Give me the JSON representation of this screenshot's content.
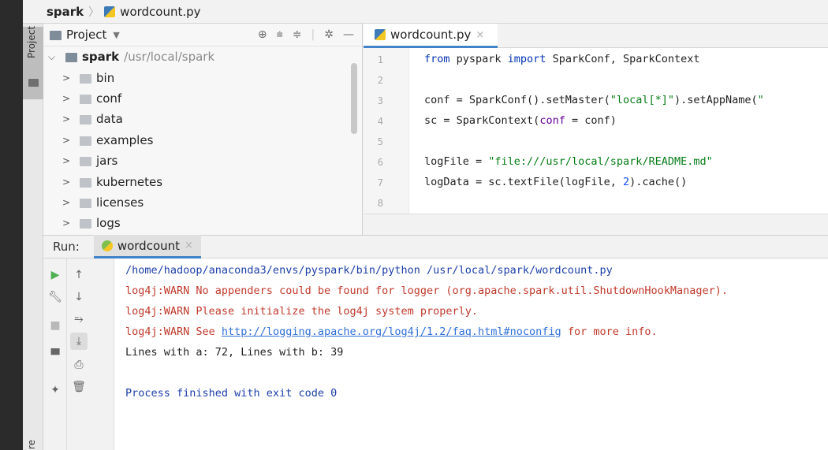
{
  "breadcrumb": {
    "project": "spark",
    "file": "wordcount.py"
  },
  "tool_stripe": {
    "project_label": "Project",
    "structure_label": "ure"
  },
  "project_panel": {
    "title": "Project",
    "dropdown_icon": "chevron-down-icon",
    "header_icons": [
      "target-icon",
      "collapse-all-icon",
      "expand-all-icon",
      "gear-icon",
      "minimize-icon"
    ],
    "root": {
      "name": "spark",
      "path": "/usr/local/spark"
    },
    "folders": [
      "bin",
      "conf",
      "data",
      "examples",
      "jars",
      "kubernetes",
      "licenses",
      "logs"
    ]
  },
  "editor": {
    "tab_label": "wordcount.py",
    "line_numbers": [
      "1",
      "2",
      "3",
      "4",
      "5",
      "6",
      "7",
      "8"
    ],
    "lines": [
      {
        "kw": "from",
        "t1": " pyspark ",
        "kw2": "import",
        "t2": " SparkConf, SparkContext"
      },
      {},
      {
        "t1": "conf = SparkConf().setMaster(",
        "s1": "\"local[*]\"",
        "t2": ").setAppName(",
        "s2": "\""
      },
      {
        "t1": "sc = SparkContext(",
        "p1": "conf",
        "t2": " = conf)"
      },
      {},
      {
        "t1": "logFile = ",
        "s1": "\"file:///usr/local/spark/README.md\""
      },
      {
        "t1": "logData = sc.textFile(logFile, ",
        "n1": "2",
        "t2": ").cache()"
      }
    ]
  },
  "run_panel": {
    "label": "Run:",
    "tab_label": "wordcount",
    "left_tools": [
      "run-icon",
      "wrench-icon",
      "stop-icon",
      "layout-icon",
      "pin-icon"
    ],
    "right_tools": [
      "up-arrow-icon",
      "down-arrow-icon",
      "soft-wrap-icon",
      "scroll-to-end-icon",
      "print-icon",
      "trash-icon"
    ],
    "console": {
      "command": "/home/hadoop/anaconda3/envs/pyspark/bin/python /usr/local/spark/wordcount.py",
      "warn1": "log4j:WARN No appenders could be found for logger (org.apache.spark.util.ShutdownHookManager).",
      "warn2": "log4j:WARN Please initialize the log4j system properly.",
      "warn3_prefix": "log4j:WARN See ",
      "warn3_link": "http://logging.apache.org/log4j/1.2/faq.html#noconfig",
      "warn3_suffix": " for more info.",
      "result": "Lines with a: 72, Lines with b: 39",
      "finished": "Process finished with exit code 0"
    }
  }
}
